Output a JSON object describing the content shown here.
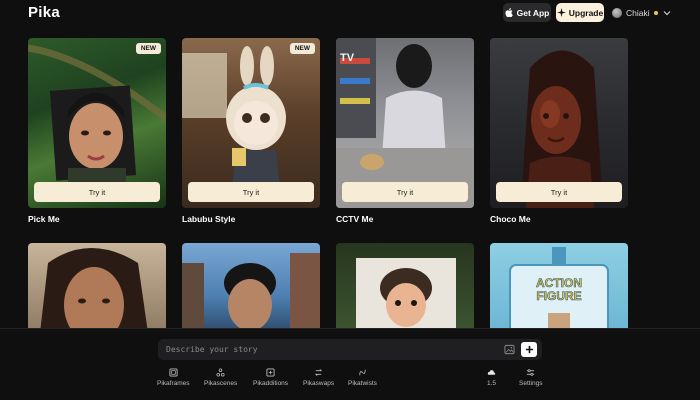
{
  "header": {
    "logo": "Pika",
    "get_app_label": "Get App",
    "upgrade_label": "Upgrade",
    "user_name": "Chiaki"
  },
  "cards": [
    {
      "title": "Pick Me",
      "button": "Try it",
      "badge": "NEW"
    },
    {
      "title": "Labubu Style",
      "button": "Try it",
      "badge": "NEW"
    },
    {
      "title": "CCTV Me",
      "button": "Try it",
      "overlay_text": "TV"
    },
    {
      "title": "Choco Me",
      "button": "Try it"
    }
  ],
  "row2_cards": [
    {
      "overlay_text": "ACTION FIGURE"
    }
  ],
  "prompt": {
    "placeholder": "Describe your story"
  },
  "toolbar": {
    "items": [
      {
        "label": "Pikaframes",
        "icon": "frame-icon"
      },
      {
        "label": "Pikascenes",
        "icon": "scenes-icon"
      },
      {
        "label": "Pikadditions",
        "icon": "add-box-icon"
      },
      {
        "label": "Pikaswaps",
        "icon": "swap-icon"
      },
      {
        "label": "Pikatwists",
        "icon": "twist-icon"
      }
    ],
    "model_version": "1.5",
    "settings_label": "Settings"
  },
  "colors": {
    "background": "#0f0f10",
    "button_cream": "#f7ecd6",
    "status_yellow": "#f5c542"
  }
}
